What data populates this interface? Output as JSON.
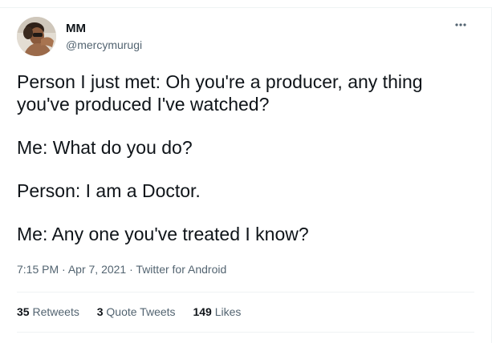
{
  "user": {
    "name": "MM",
    "handle": "@mercymurugi"
  },
  "tweet": {
    "paragraphs": [
      "Person I just met: Oh you're a producer, any thing you've produced I've watched?",
      "Me: What do you do?",
      "Person: I am a Doctor.",
      "Me: Any one you've treated I know?"
    ],
    "time": "7:15 PM",
    "date": "Apr 7, 2021",
    "source": "Twitter for Android",
    "separator": "·"
  },
  "stats": {
    "retweets_count": "35",
    "retweets_label": "Retweets",
    "quotes_count": "3",
    "quotes_label": "Quote Tweets",
    "likes_count": "149",
    "likes_label": "Likes"
  },
  "icons": {
    "more": "more-options-icon"
  },
  "colors": {
    "text": "#0f1419",
    "secondary": "#536471",
    "divider": "#eff3f4"
  }
}
